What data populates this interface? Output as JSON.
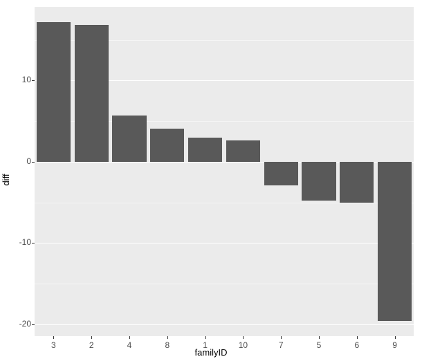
{
  "chart_data": {
    "type": "bar",
    "categories": [
      "3",
      "2",
      "4",
      "8",
      "1",
      "10",
      "7",
      "5",
      "6",
      "9"
    ],
    "values": [
      17.2,
      16.8,
      5.7,
      4.1,
      3.0,
      2.6,
      -2.9,
      -4.8,
      -5.0,
      -19.6
    ],
    "xlabel": "familyID",
    "ylabel": "diff",
    "ylim": [
      -20,
      18
    ],
    "yticks": [
      -20,
      -10,
      0,
      10
    ],
    "yminor": [
      -15,
      -5,
      5,
      15
    ],
    "bar_fill": "#595959",
    "panel_bg": "#ebebeb"
  }
}
